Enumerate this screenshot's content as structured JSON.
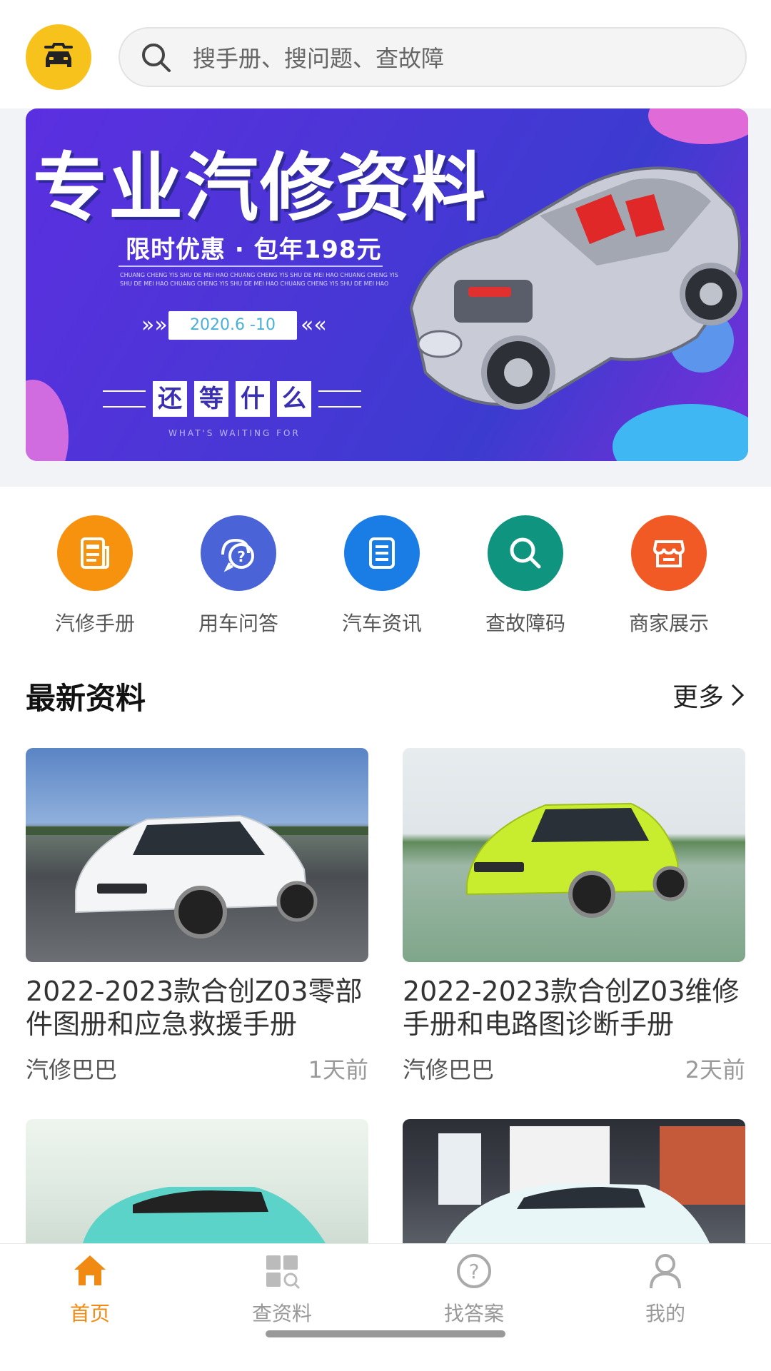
{
  "search": {
    "placeholder": "搜手册、搜问题、查故障"
  },
  "banner": {
    "title": "专业汽修资料",
    "subtitle": "限时优惠 · 包年198元",
    "small_text": "CHUANG CHENG YIS SHU DE MEI HAO CHUANG CHENG YIS SHU DE MEI HAO CHUANG CHENG YIS SHU DE MEI HAO CHUANG CHENG YIS SHU DE MEI HAO CHUANG CHENG YIS SHU DE MEI HAO",
    "date": "2020.6 -10",
    "chars": [
      "还",
      "等",
      "什",
      "么"
    ],
    "tagline": "WHAT'S WAITING FOR"
  },
  "menu": [
    {
      "label": "汽修手册",
      "icon": "manual-icon",
      "color": "#f7920f"
    },
    {
      "label": "用车问答",
      "icon": "qa-icon",
      "color": "#4a63d6"
    },
    {
      "label": "汽车资讯",
      "icon": "news-icon",
      "color": "#1a7de6"
    },
    {
      "label": "查故障码",
      "icon": "search-icon",
      "color": "#0f9480"
    },
    {
      "label": "商家展示",
      "icon": "store-icon",
      "color": "#f15a24"
    }
  ],
  "section": {
    "title": "最新资料",
    "more": "更多"
  },
  "cards": [
    {
      "title": "2022-2023款合创Z03零部件图册和应急救援手册",
      "source": "汽修巴巴",
      "time": "1天前",
      "car_color": "#f4f5f7"
    },
    {
      "title": "2022-2023款合创Z03维修手册和电路图诊断手册",
      "source": "汽修巴巴",
      "time": "2天前",
      "car_color": "#c8ec2e"
    },
    {
      "title": "",
      "source": "",
      "time": "",
      "car_color": "#5cd3c8"
    },
    {
      "title": "",
      "source": "",
      "time": "",
      "car_color": "#e8f6f7"
    }
  ],
  "tabs": [
    {
      "label": "首页",
      "icon": "home-icon",
      "active": true
    },
    {
      "label": "查资料",
      "icon": "grid-search-icon",
      "active": false
    },
    {
      "label": "找答案",
      "icon": "question-icon",
      "active": false
    },
    {
      "label": "我的",
      "icon": "user-icon",
      "active": false
    }
  ],
  "colors": {
    "accent": "#f08a12",
    "logo": "#f8c21c"
  }
}
